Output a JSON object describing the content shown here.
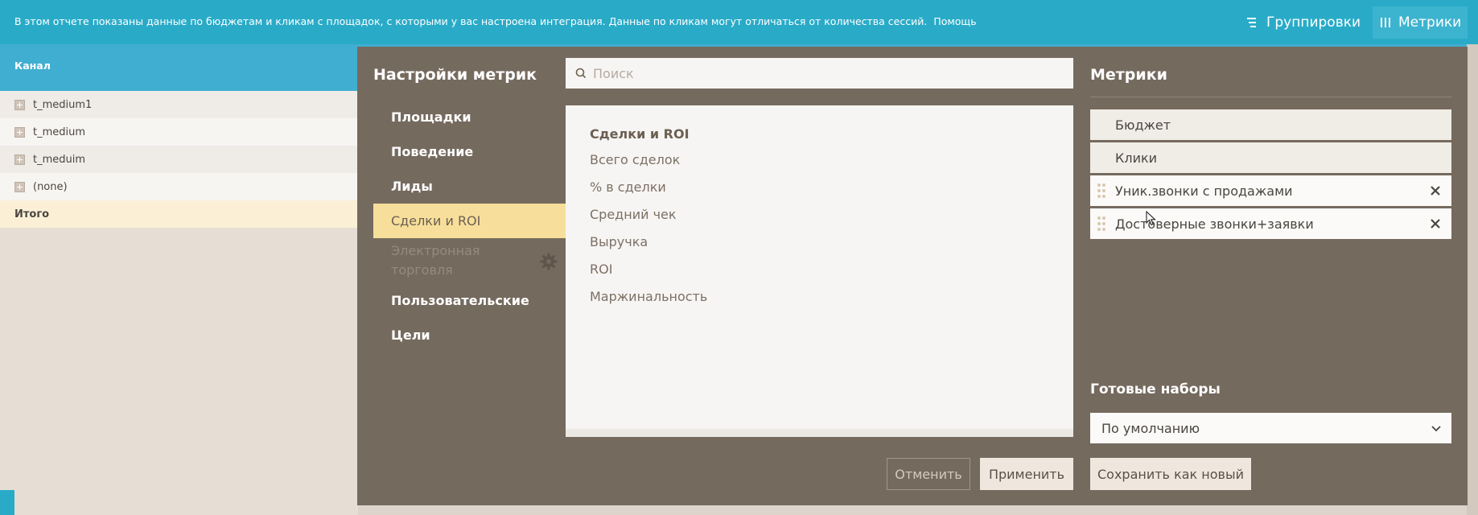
{
  "topbar": {
    "info": "В этом отчете показаны данные по бюджетам и кликам с площадок, с которыми у вас настроена интеграция. Данные по кликам могут отличаться от количества сессий.",
    "help": "Помощь",
    "groupings_label": "Группировки",
    "metrics_label": "Метрики"
  },
  "table": {
    "column_label": "Канал",
    "rows": [
      {
        "label": "t_medium1"
      },
      {
        "label": "t_medium"
      },
      {
        "label": "t_meduim"
      },
      {
        "label": "(none)"
      }
    ],
    "total_label": "Итого"
  },
  "panel": {
    "title": "Настройки метрик",
    "search_placeholder": "Поиск",
    "categories": [
      {
        "label": "Площадки"
      },
      {
        "label": "Поведение"
      },
      {
        "label": "Лиды"
      },
      {
        "label": "Сделки и ROI",
        "active": true
      },
      {
        "label": "Электронная торговля",
        "disabled": true
      },
      {
        "label": "Пользовательские"
      },
      {
        "label": "Цели"
      }
    ],
    "list_title": "Сделки и ROI",
    "list_items": [
      "Всего сделок",
      "% в сделки",
      "Средний чек",
      "Выручка",
      "ROI",
      "Маржинальность"
    ],
    "metrics_title": "Метрики",
    "selected_metrics": [
      {
        "label": "Бюджет",
        "removable": false
      },
      {
        "label": "Клики",
        "removable": false
      },
      {
        "label": "Уник.звонки с продажами",
        "removable": true
      },
      {
        "label": "Достоверные звонки+заявки",
        "removable": true
      }
    ],
    "presets_title": "Готовые наборы",
    "preset_value": "По умолчанию",
    "cancel_label": "Отменить",
    "apply_label": "Применить",
    "save_new_label": "Сохранить как новый"
  },
  "colors": {
    "topbar": "#29abc8",
    "panel": "#756a5e",
    "active_category": "#f7df9b"
  }
}
